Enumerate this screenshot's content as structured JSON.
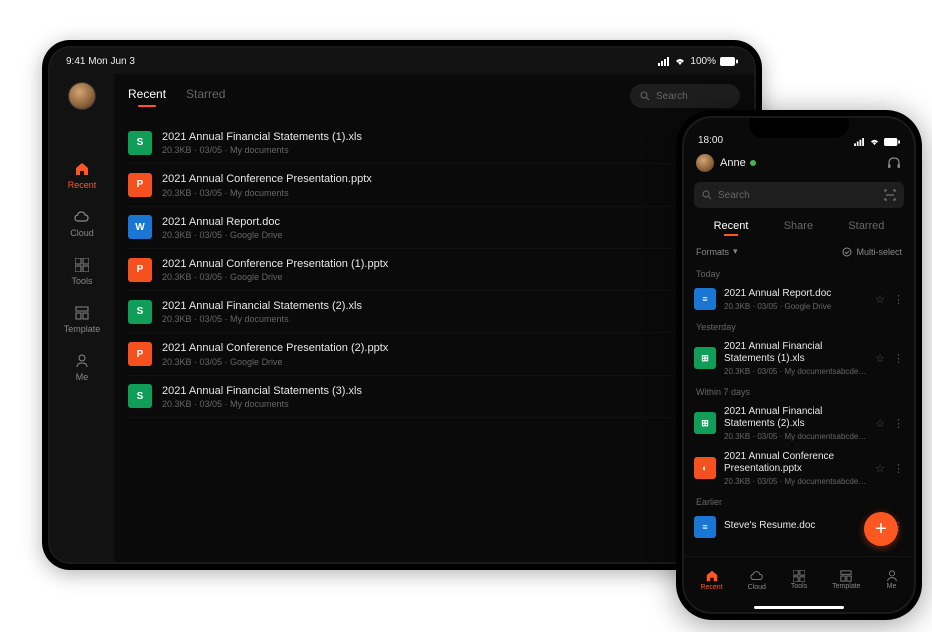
{
  "tablet": {
    "status": {
      "time": "9:41 Mon Jun 3",
      "signal": "...l",
      "wifi": "wifi",
      "battery_pct": "100%"
    },
    "tabs": {
      "recent": "Recent",
      "starred": "Starred"
    },
    "search_placeholder": "Search",
    "sidebar": {
      "recent": "Recent",
      "cloud": "Cloud",
      "tools": "Tools",
      "template": "Template",
      "me": "Me"
    },
    "files": [
      {
        "icon": "S",
        "cls": "fi-s",
        "name": "2021 Annual Financial Statements (1).xls",
        "meta": "20.3KB · 03/05 · My documents"
      },
      {
        "icon": "P",
        "cls": "fi-p",
        "name": "2021 Annual Conference Presentation.pptx",
        "meta": "20.3KB · 03/05 · My documents"
      },
      {
        "icon": "W",
        "cls": "fi-w",
        "name": "2021 Annual Report.doc",
        "meta": "20.3KB · 03/05 · Google Drive"
      },
      {
        "icon": "P",
        "cls": "fi-p",
        "name": "2021 Annual Conference Presentation (1).pptx",
        "meta": "20.3KB · 03/05 · Google Drive"
      },
      {
        "icon": "S",
        "cls": "fi-s",
        "name": "2021 Annual Financial Statements (2).xls",
        "meta": "20.3KB · 03/05 · My documents"
      },
      {
        "icon": "P",
        "cls": "fi-p",
        "name": "2021 Annual Conference Presentation (2).pptx",
        "meta": "20.3KB · 03/05 · Google Drive"
      },
      {
        "icon": "S",
        "cls": "fi-s",
        "name": "2021 Annual Financial Statements (3).xls",
        "meta": "20.3KB · 03/05 · My documents"
      }
    ]
  },
  "phone": {
    "status": {
      "time": "18:00"
    },
    "user": "Anne",
    "search_placeholder": "Search",
    "tabs": {
      "recent": "Recent",
      "share": "Share",
      "starred": "Starred"
    },
    "filter": {
      "formats": "Formats",
      "multiselect": "Multi-select"
    },
    "sections": [
      {
        "label": "Today",
        "items": [
          {
            "icon": "≡",
            "cls": "fi-d",
            "name": "2021 Annual Report.doc",
            "meta": "20.3KB · 03/05 · Google Drive"
          }
        ]
      },
      {
        "label": "Yesterday",
        "items": [
          {
            "icon": "⊞",
            "cls": "fi-s",
            "name": "2021 Annual Financial Statements (1).xls",
            "meta": "20.3KB · 03/05 · My documentsabcdefgh..."
          }
        ]
      },
      {
        "label": "Within 7 days",
        "items": [
          {
            "icon": "⊞",
            "cls": "fi-s",
            "name": "2021 Annual Financial Statements (2).xls",
            "meta": "20.3KB · 03/05 · My documentsabcdefgh..."
          },
          {
            "icon": "◐",
            "cls": "fi-p",
            "name": "2021 Annual Conference Presentation.pptx",
            "meta": "20.3KB · 03/05 · My documentsabcdefgh..."
          }
        ]
      },
      {
        "label": "Earlier",
        "items": [
          {
            "icon": "≡",
            "cls": "fi-d",
            "name": "Steve's Resume.doc",
            "meta": ""
          }
        ]
      }
    ],
    "nav": {
      "recent": "Recent",
      "cloud": "Cloud",
      "tools": "Tools",
      "template": "Template",
      "me": "Me"
    }
  }
}
